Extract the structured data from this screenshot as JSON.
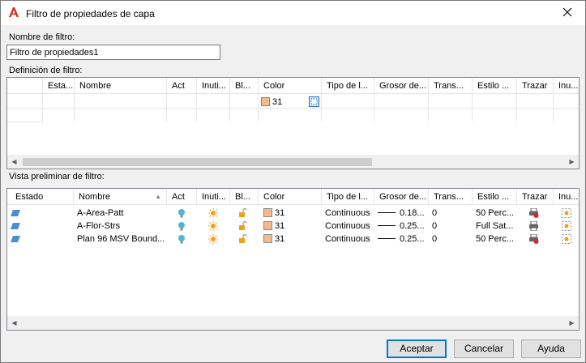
{
  "window": {
    "title": "Filtro de propiedades de capa"
  },
  "filter_name": {
    "label": "Nombre de filtro:",
    "value": "Filtro de propiedades1"
  },
  "definition": {
    "label": "Definición de filtro:",
    "columns": [
      "Esta...",
      "Nombre",
      "Act",
      "Inuti...",
      "Bl...",
      "Color",
      "Tipo de l...",
      "Grosor de...",
      "Trans...",
      "Estilo ...",
      "Trazar",
      "Inu..."
    ],
    "row": {
      "color_value": "31"
    }
  },
  "preview": {
    "label": "Vista preliminar de filtro:",
    "columns": [
      "Estado",
      "Nombre",
      "Act",
      "Inuti...",
      "Bl...",
      "Color",
      "Tipo de l...",
      "Grosor de...",
      "Trans...",
      "Estilo ...",
      "Trazar",
      "Inu..."
    ],
    "rows": [
      {
        "name": "A-Area-Patt",
        "color": "31",
        "linetype": "Continuous",
        "lineweight": "0.18...",
        "transparency": "0",
        "plot_style": "50 Perc..."
      },
      {
        "name": "A-Flor-Strs",
        "color": "31",
        "linetype": "Continuous",
        "lineweight": "0.25...",
        "transparency": "0",
        "plot_style": "Full Sat..."
      },
      {
        "name": "Plan 96 MSV Bound...",
        "color": "31",
        "linetype": "Continuous",
        "lineweight": "0.25...",
        "transparency": "0",
        "plot_style": "50 Perc..."
      }
    ]
  },
  "buttons": {
    "ok": "Aceptar",
    "cancel": "Cancelar",
    "help": "Ayuda"
  },
  "colors": {
    "swatch": "#f7b98a",
    "accent": "#0078d7",
    "bulb": "#56b4d3",
    "sun": "#f0a020",
    "lock": "#e8a317"
  },
  "icons": {
    "app": "autocad-logo-icon",
    "close": "close-icon",
    "sort": "sort-up-icon"
  }
}
